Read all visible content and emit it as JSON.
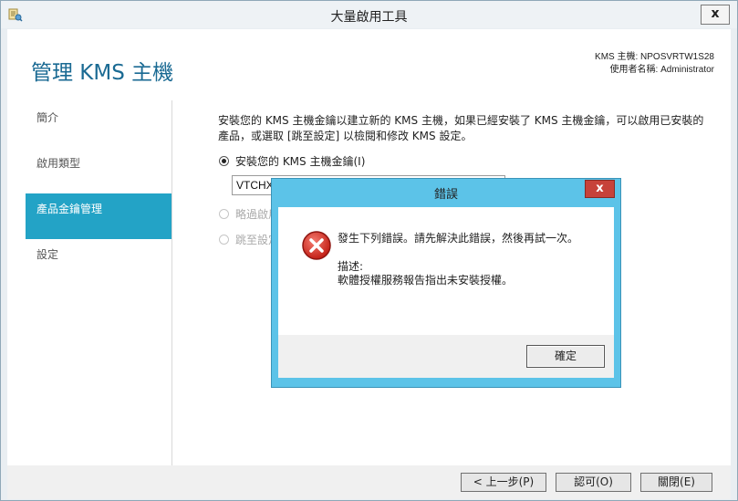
{
  "window": {
    "title": "大量啟用工具",
    "close_glyph": "x",
    "icon": "volume-activation-icon"
  },
  "header": {
    "page_title": "管理 KMS 主機",
    "kms_host_label": "KMS 主機: NPOSVRTW1S28",
    "user_label": "使用者名稱: Administrator"
  },
  "nav": {
    "items": [
      {
        "label": "簡介",
        "active": false
      },
      {
        "label": "啟用類型",
        "active": false
      },
      {
        "label": "產品金鑰管理",
        "active": true
      },
      {
        "label": "設定",
        "active": false
      }
    ],
    "active_color": "#23a3c6"
  },
  "main": {
    "description": "安裝您的 KMS 主機金鑰以建立新的 KMS 主機，如果已經安裝了 KMS 主機金鑰，可以啟用已安裝的產品，或選取 [跳至設定] 以檢閱和修改 KMS 設定。",
    "options": [
      {
        "label": "安裝您的 KMS 主機金鑰(I)",
        "checked": true,
        "enabled": true
      },
      {
        "label": "略過啟用",
        "checked": false,
        "enabled": false
      },
      {
        "label": "跳至設定",
        "checked": false,
        "enabled": false
      }
    ],
    "key_value": "VTCHX"
  },
  "footer": {
    "back_label": "< 上一步(P)",
    "commit_label": "認可(O)",
    "close_label": "關閉(E)"
  },
  "dialog": {
    "title": "錯誤",
    "close_glyph": "x",
    "message": "發生下列錯誤。請先解決此錯誤，然後再試一次。",
    "desc_label": "描述:",
    "desc_text": "軟體授權服務報告指出未安裝授權。",
    "ok_label": "確定",
    "icon": "error-icon",
    "title_color": "#5cc3e8",
    "close_color": "#c7423a"
  }
}
